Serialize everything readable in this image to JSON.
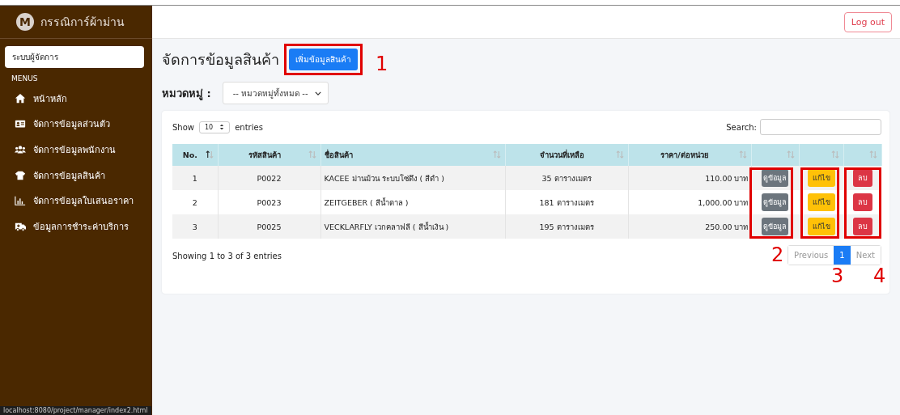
{
  "sidebar": {
    "brand": {
      "logo_letter": "M",
      "title": "กรรณิการ์ผ้าม่าน"
    },
    "role": "ระบบผู้จัดการ",
    "section": "MENUS",
    "items": [
      {
        "kind": "home",
        "label": "หน้าหลัก"
      },
      {
        "kind": "card",
        "label": "จัดการข้อมูลส่วนตัว"
      },
      {
        "kind": "users",
        "label": "จัดการข้อมูลพนักงาน"
      },
      {
        "kind": "shirt",
        "label": "จัดการข้อมูลสินค้า"
      },
      {
        "kind": "chart",
        "label": "จัดการข้อมูลใบเสนอราคา"
      },
      {
        "kind": "truck",
        "label": "ข้อมูลการชำระค่าบริการ"
      }
    ]
  },
  "topbar": {
    "logout": "Log out"
  },
  "page": {
    "title": "จัดการข้อมูลสินค้า",
    "add_button": "เพิ่มข้อมูลสินค้า",
    "category_label": "หมวดหมู่ :",
    "category_value": "-- หมวดหมู่ทั้งหมด --"
  },
  "table": {
    "show": "Show",
    "page_size": "10",
    "entries": "entries",
    "search_label": "Search:",
    "columns": [
      {
        "label": "No.",
        "sorted": true
      },
      {
        "label": "รหัสสินค้า",
        "sorted": false
      },
      {
        "label": "ชื่อสินค้า",
        "sorted": false
      },
      {
        "label": "จำนวนที่เหลือ",
        "sorted": false
      },
      {
        "label": "ราคา/ต่อหน่วย",
        "sorted": false
      },
      {
        "sorted": false
      },
      {
        "sorted": false
      },
      {
        "sorted": false
      }
    ],
    "rows": [
      {
        "no": "1",
        "code": "P0022",
        "name": "KACEE ม่านม้วน ระบบโซ่ดึง ( สีดำ )",
        "qty": "35 ตารางเมตร",
        "price": "110.00 บาท",
        "actions": [
          {
            "kind": "view",
            "label": "ดูข้อมูล"
          },
          {
            "kind": "edit",
            "label": "แก้ไข"
          },
          {
            "kind": "delete",
            "label": "ลบ"
          }
        ]
      },
      {
        "no": "2",
        "code": "P0023",
        "name": "ZEITGEBER ( สีน้ำตาล )",
        "qty": "181 ตารางเมตร",
        "price": "1,000.00 บาท",
        "actions": [
          {
            "kind": "view",
            "label": "ดูข้อมูล"
          },
          {
            "kind": "edit",
            "label": "แก้ไข"
          },
          {
            "kind": "delete",
            "label": "ลบ"
          }
        ]
      },
      {
        "no": "3",
        "code": "P0025",
        "name": "VECKLARFLY เวกคลาฟลี ( สีน้ำเงิน )",
        "qty": "195 ตารางเมตร",
        "price": "250.00 บาท",
        "actions": [
          {
            "kind": "view",
            "label": "ดูข้อมูล"
          },
          {
            "kind": "edit",
            "label": "แก้ไข"
          },
          {
            "kind": "delete",
            "label": "ลบ"
          }
        ]
      }
    ],
    "info": "Showing 1 to 3 of 3 entries",
    "pagination": [
      {
        "label": "Previous",
        "selected": false
      },
      {
        "label": "1",
        "selected": true
      },
      {
        "label": "Next",
        "selected": false
      }
    ]
  },
  "annotations": [
    {
      "label": "1"
    },
    {
      "label": "2"
    },
    {
      "label": "3"
    },
    {
      "label": "4"
    }
  ],
  "status_bar": "localhost:8080/project/manager/index2.html"
}
